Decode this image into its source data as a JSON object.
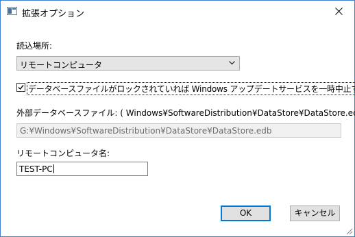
{
  "titlebar": {
    "title": "拡張オプション",
    "close_icon": "close-icon"
  },
  "location": {
    "label": "読込場所:",
    "selected": "リモートコンピュータ",
    "dropdown_icon": "chevron-down-icon"
  },
  "skip_locked": {
    "checked": true,
    "label": "データベースファイルがロックされていれば Windows アップデートサービスを一時中止する"
  },
  "external_db": {
    "label": "外部データベースファイル: ( Windows¥SoftwareDistribution¥DataStore¥DataStore.edb )",
    "value": "G:¥Windows¥SoftwareDistribution¥DataStore¥DataStore.edb"
  },
  "remote_name": {
    "label": "リモートコンピュータ名:",
    "value": "TEST-PC"
  },
  "buttons": {
    "ok": "OK",
    "cancel": "キャンセル"
  },
  "colors": {
    "window_border": "#3f7fd1",
    "primary_button_border": "#0078d7",
    "button_bg": "#e1e1e1"
  }
}
